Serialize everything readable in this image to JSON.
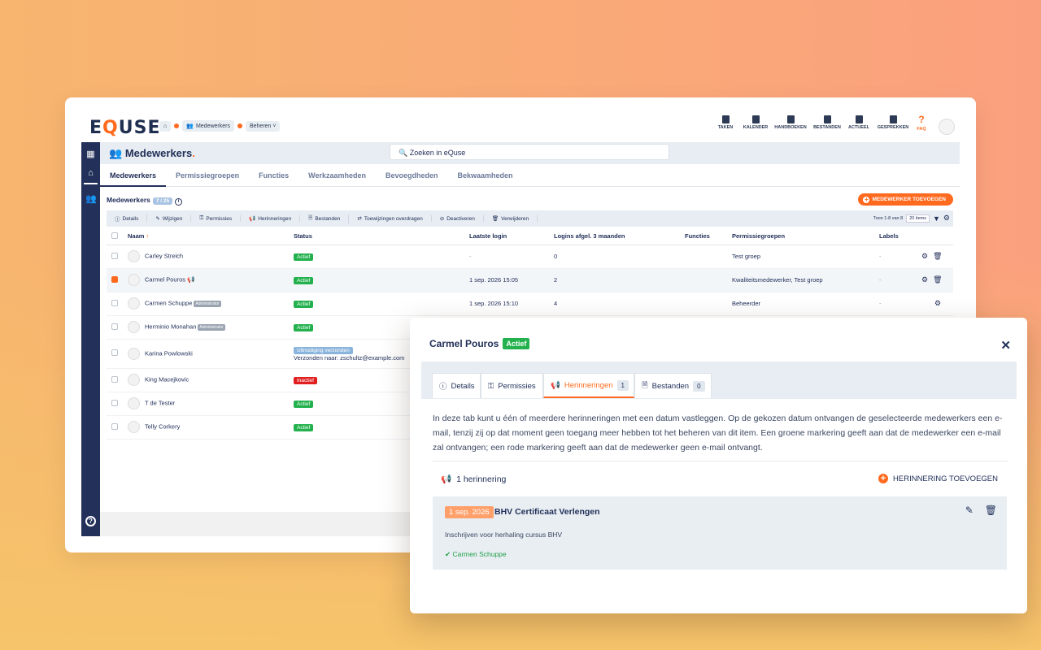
{
  "app": {
    "logo": {
      "e": "E",
      "q": "Q",
      "rest": "USE"
    },
    "breadcrumb": [
      "Medewerkers",
      "Beheren ˅"
    ],
    "topnav": [
      "TAKEN",
      "KALENDER",
      "HANDBOEKEN",
      "BESTANDEN",
      "ACTUEEL",
      "GESPREKKEN",
      "FAQ"
    ],
    "page_title": "Medewerkers",
    "page_title_dot": ".",
    "search_placeholder": "Zoeken in eQuse",
    "tabs": [
      "Medewerkers",
      "Permissiegroepen",
      "Functies",
      "Werkzaamheden",
      "Bevoegdheden",
      "Bekwaamheden"
    ],
    "section_title": "Medewerkers",
    "section_count": "7 / 25",
    "add_button": "MEDEWERKER TOEVOEGEN",
    "toolbar": [
      "Details",
      "Wijzigen",
      "Permissies",
      "Herinneringen",
      "Bestanden",
      "Toewijzingen overdragen",
      "Deactiveren",
      "Verwijderen"
    ],
    "paging_text": "Toon 1-8 van 8",
    "page_size": "20 items",
    "columns": [
      "Naam",
      "Status",
      "Laatste login",
      "Logins afgel. 3 maanden",
      "Functies",
      "Permissiegroepen",
      "Labels"
    ],
    "rows": [
      {
        "name": "Carley Streich",
        "tag": "",
        "status": "Actief",
        "login": "-",
        "logins": "0",
        "functies": "",
        "groups": "Test groep",
        "labels": "-"
      },
      {
        "name": "Carmel Pouros",
        "tag": "",
        "status": "Actief",
        "login": "1 sep. 2026 15:05",
        "logins": "2",
        "functies": "",
        "groups": "Kwaliteitsmedewerker, Test groep",
        "labels": "-"
      },
      {
        "name": "Carmen Schuppe",
        "tag": "Administrator",
        "status": "Actief",
        "login": "1 sep. 2026 15:10",
        "logins": "4",
        "functies": "",
        "groups": "Beheerder",
        "labels": "-"
      },
      {
        "name": "Herminio Monahan",
        "tag": "Administrator",
        "status": "Actief",
        "login": "",
        "logins": "",
        "functies": "",
        "groups": "",
        "labels": ""
      },
      {
        "name": "Karina Powlowski",
        "tag": "",
        "status": "Uitnodiging verzonden",
        "status_note": "Verzonden naar: zschultz@example.com",
        "login": "",
        "logins": "",
        "functies": "",
        "groups": "",
        "labels": ""
      },
      {
        "name": "King Macejkovic",
        "tag": "",
        "status": "Inactief",
        "login": "",
        "logins": "",
        "functies": "",
        "groups": "",
        "labels": ""
      },
      {
        "name": "T de Tester",
        "tag": "",
        "status": "Actief",
        "login": "",
        "logins": "",
        "functies": "",
        "groups": "",
        "labels": ""
      },
      {
        "name": "Telly Corkery",
        "tag": "",
        "status": "Actief",
        "login": "",
        "logins": "",
        "functies": "",
        "groups": "",
        "labels": ""
      }
    ]
  },
  "modal": {
    "title": "Carmel Pouros",
    "status": "Actief",
    "tabs": [
      {
        "label": "Details",
        "count": ""
      },
      {
        "label": "Permissies",
        "count": ""
      },
      {
        "label": "Herinneringen",
        "count": "1"
      },
      {
        "label": "Bestanden",
        "count": "0"
      }
    ],
    "description": "In deze tab kunt u één of meerdere herinneringen met een datum vastleggen. Op de gekozen datum ontvangen de geselecteerde medewerkers een e-mail, tenzij zij op dat moment geen toegang meer hebben tot het beheren van dit item. Een groene markering geeft aan dat de medewerker een e-mail zal ontvangen; een rode markering geeft aan dat de medewerker geen e-mail ontvangt.",
    "reminder_count": "1 herinnering",
    "add_reminder": "HERINNERING TOEVOEGEN",
    "reminder": {
      "date": "1 sep. 2026",
      "title": "BHV Certificaat Verlengen",
      "subtitle": "Inschrijven voor herhaling cursus BHV",
      "person": "Carmen Schuppe"
    }
  },
  "colors": {
    "accent": "#ff6a1f",
    "navy": "#22305a",
    "green": "#22b14c",
    "red": "#e02020"
  }
}
